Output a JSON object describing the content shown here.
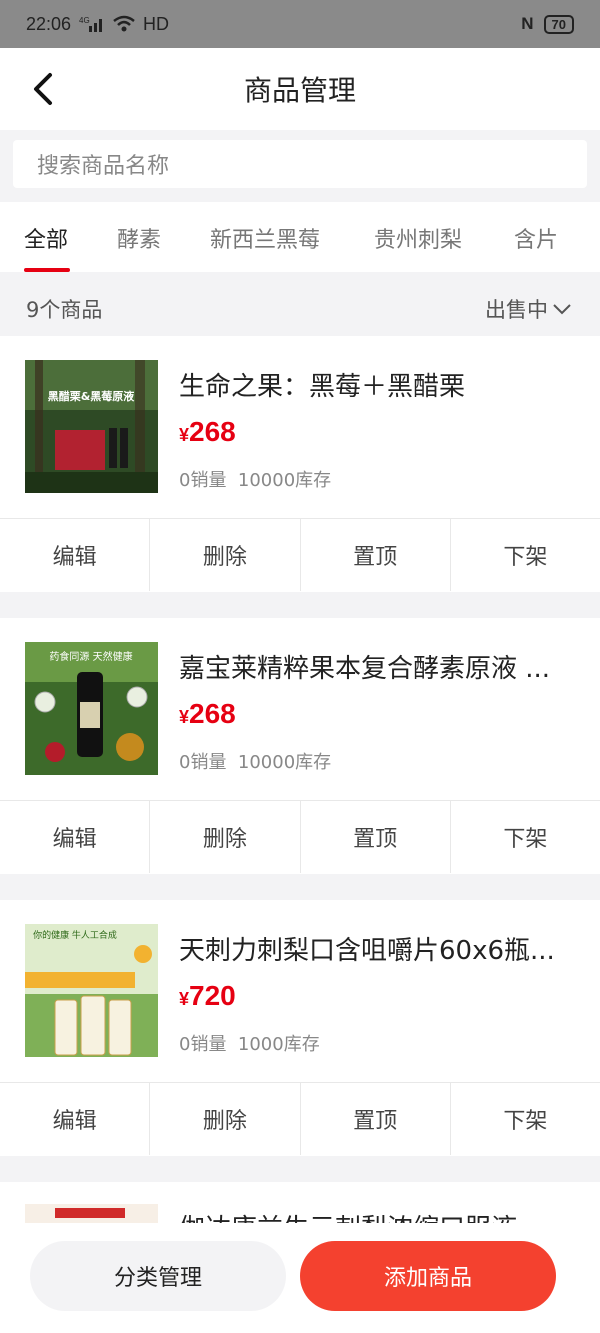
{
  "status": {
    "time": "22:06",
    "network": "4G",
    "wifi_label": "HD",
    "battery": "70"
  },
  "header": {
    "title": "商品管理"
  },
  "search": {
    "placeholder": "搜索商品名称"
  },
  "tabs": [
    "全部",
    "酵素",
    "新西兰黑莓",
    "贵州刺梨",
    "含片"
  ],
  "summary": {
    "count": "9个商品",
    "filter": "出售中"
  },
  "products": [
    {
      "name": "生命之果：黑莓＋黑醋栗",
      "currency": "¥",
      "price": "268",
      "sold": "0销量",
      "stock": "10000库存",
      "thumb_text": "黑醋栗&黑莓原液"
    },
    {
      "name": "嘉宝莱精粹果本复合酵素原液 ...",
      "currency": "¥",
      "price": "268",
      "sold": "0销量",
      "stock": "10000库存",
      "thumb_text": "药食同源 天然健康"
    },
    {
      "name": "天刺力刺梨口含咀嚼片60x6瓶...",
      "currency": "¥",
      "price": "720",
      "sold": "0销量",
      "stock": "1000库存",
      "thumb_text": "你的健康 牛人工合成"
    },
    {
      "name": "伽达康益生元刺梨浓缩口服液",
      "currency": "¥",
      "price": "",
      "sold": "",
      "stock": ""
    }
  ],
  "actions": [
    "编辑",
    "删除",
    "置顶",
    "下架"
  ],
  "bottom": {
    "category_btn": "分类管理",
    "add_btn": "添加商品"
  },
  "colors": {
    "accent": "#e60012",
    "add_button": "#f4412f",
    "background": "#f3f3f5"
  }
}
